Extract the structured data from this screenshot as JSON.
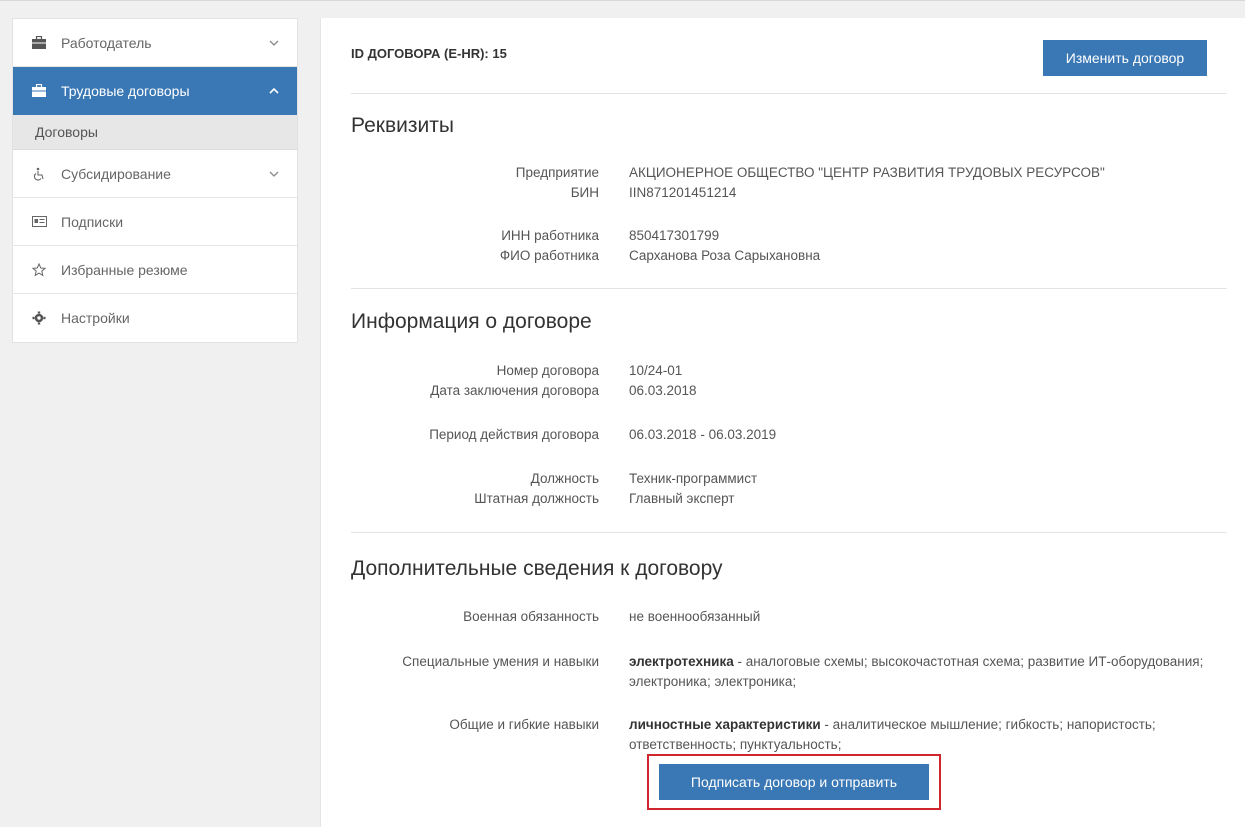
{
  "sidebar": {
    "items": [
      {
        "label": "Работодатель",
        "icon": "briefcase-icon"
      },
      {
        "label": "Трудовые договоры",
        "icon": "briefcase-icon"
      },
      {
        "label": "Договоры"
      },
      {
        "label": "Субсидирование",
        "icon": "accessibility-icon"
      },
      {
        "label": "Подписки",
        "icon": "subscription-card-icon"
      },
      {
        "label": "Избранные резюме",
        "icon": "star-icon"
      },
      {
        "label": "Настройки",
        "icon": "gear-icon"
      }
    ]
  },
  "header": {
    "contract_id": "ID ДОГОВОРА (E-HR): 15",
    "edit_button": "Изменить договор"
  },
  "requisites": {
    "title": "Реквизиты",
    "enterprise_label": "Предприятие",
    "enterprise_value": "АКЦИОНЕРНОЕ ОБЩЕСТВО \"ЦЕНТР РАЗВИТИЯ ТРУДОВЫХ РЕСУРСОВ\"",
    "bin_label": "БИН",
    "bin_value": "IIN871201451214",
    "iin_label": "ИНН работника",
    "iin_value": "850417301799",
    "fio_label": "ФИО работника",
    "fio_value": "Сарханова Роза Сарыхановна"
  },
  "contract_info": {
    "title": "Информация о договоре",
    "number_label": "Номер договора",
    "number_value": "10/24-01",
    "date_label": "Дата заключения договора",
    "date_value": "06.03.2018",
    "period_label": "Период действия договора",
    "period_value": "06.03.2018 - 06.03.2019",
    "position_label": "Должность",
    "position_value": "Техник-программист",
    "staff_position_label": "Штатная должность",
    "staff_position_value": "Главный эксперт"
  },
  "additional": {
    "title": "Дополнительные сведения к договору",
    "military_label": "Военная обязанность",
    "military_value": "не военнообязанный",
    "special_label": "Специальные умения и навыки",
    "special_bold": "электротехника",
    "special_rest": " - аналоговые схемы; высокочастотная схема; развитие ИТ-оборудования; электроника; электроника;",
    "soft_label": "Общие и гибкие навыки",
    "soft_bold": "личностные характеристики",
    "soft_rest": " - аналитическое мышление; гибкость; напористость; ответственность; пунктуальность;"
  },
  "sign_button": "Подписать договор и отправить",
  "colors": {
    "accent": "#3a78b5",
    "highlight": "#d0262d"
  }
}
